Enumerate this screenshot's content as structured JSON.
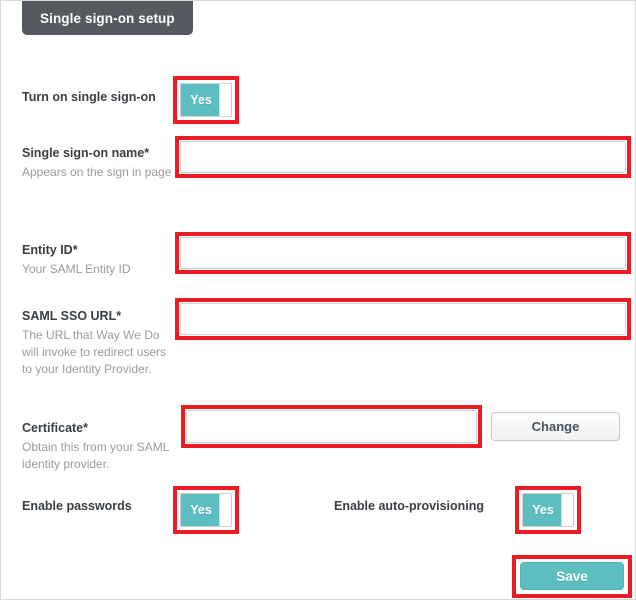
{
  "header": {
    "tab_label": "Single sign-on setup"
  },
  "form": {
    "rows": [
      {
        "key": "turn_on_sso",
        "label": "Turn on single sign-on",
        "help": "",
        "control": "toggle",
        "toggle_value": "Yes",
        "highlighted": true
      },
      {
        "key": "sso_name",
        "label": "Single sign-on name*",
        "help": "Appears on the sign in page",
        "control": "text",
        "value": "",
        "highlighted": true
      },
      {
        "key": "entity_id",
        "label": "Entity ID*",
        "help": "Your SAML Entity ID",
        "control": "text",
        "value": "",
        "highlighted": true
      },
      {
        "key": "saml_sso_url",
        "label": "SAML SSO URL*",
        "help": "The URL that Way We Do will invoke to redirect users to your Identity Provider.",
        "control": "text",
        "value": "",
        "highlighted": true
      },
      {
        "key": "certificate",
        "label": "Certificate*",
        "help": "Obtain this from your SAML identity provider.",
        "control": "text-with-button",
        "value": "",
        "button_label": "Change",
        "highlighted": true
      }
    ],
    "enable_passwords": {
      "label": "Enable passwords",
      "toggle_value": "Yes",
      "highlighted": true
    },
    "enable_auto_provisioning": {
      "label": "Enable auto-provisioning",
      "toggle_value": "Yes",
      "highlighted": true
    },
    "save_button": {
      "label": "Save",
      "highlighted": true
    }
  },
  "colors": {
    "tab_background": "#555a60",
    "accent_teal": "#5cbec0",
    "annotation_red": "#ed1c24",
    "label_text": "#3a3f44",
    "help_text": "#9b9b9b",
    "field_border": "#d5d5d5"
  }
}
